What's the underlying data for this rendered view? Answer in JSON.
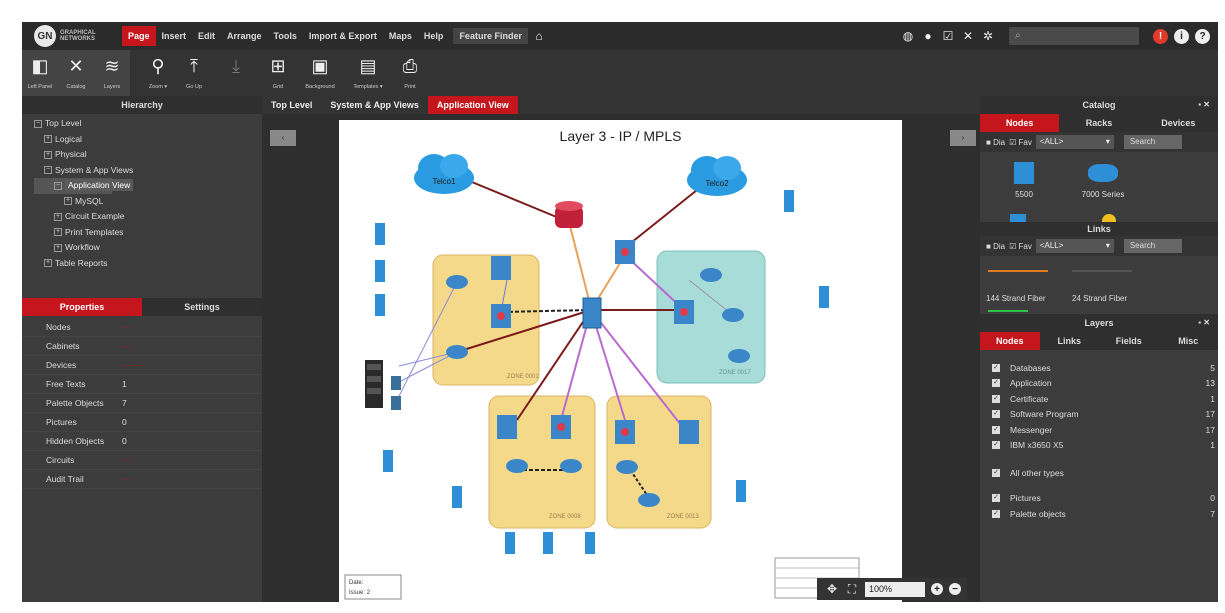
{
  "menu": {
    "logo_text": [
      "GRAPHICAL",
      "NETWORKS"
    ],
    "logo_mark": "GN",
    "items": [
      "Page",
      "Insert",
      "Edit",
      "Arrange",
      "Tools",
      "Import & Export",
      "Maps",
      "Help"
    ],
    "active": "Page",
    "feature_finder": "Feature Finder",
    "right_icons": [
      "globe-icon",
      "circle-icon",
      "checkbox-icon",
      "tools-icon",
      "gear-icon"
    ],
    "search_glyph": "⌕",
    "alert_circles": [
      "!",
      "i",
      "?"
    ]
  },
  "toolbar": [
    {
      "label": "Left Panel",
      "glyph": "◧",
      "icon": "left-panel-icon"
    },
    {
      "label": "Catalog",
      "glyph": "✕",
      "icon": "catalog-icon"
    },
    {
      "label": "Layers",
      "glyph": "≋",
      "icon": "layers-icon"
    },
    {
      "label": "Zoom ▾",
      "glyph": "⚲",
      "icon": "zoom-icon"
    },
    {
      "label": "Go Up",
      "glyph": "⤒",
      "icon": "go-up-icon"
    },
    {
      "label": "",
      "glyph": "⤓",
      "icon": "download-icon",
      "dim": true
    },
    {
      "label": "Grid",
      "glyph": "⊞",
      "icon": "grid-icon"
    },
    {
      "label": "Background",
      "glyph": "▣",
      "icon": "background-icon"
    },
    {
      "label": "Templates ▾",
      "glyph": "▤",
      "icon": "templates-icon"
    },
    {
      "label": "Print",
      "glyph": "⎙",
      "icon": "print-icon"
    }
  ],
  "hierarchy": {
    "title": "Hierarchy",
    "nodes": [
      {
        "label": "Top Level",
        "indent": 0,
        "box": "−"
      },
      {
        "label": "Logical",
        "indent": 1,
        "box": "+"
      },
      {
        "label": "Physical",
        "indent": 1,
        "box": "+"
      },
      {
        "label": "System & App Views",
        "indent": 1,
        "box": "−"
      },
      {
        "label": "Application View",
        "indent": 2,
        "box": "−",
        "selected": true
      },
      {
        "label": "MySQL",
        "indent": 3,
        "box": "+"
      },
      {
        "label": "Circuit Example",
        "indent": 2,
        "box": "+"
      },
      {
        "label": "Print Templates",
        "indent": 2,
        "box": "+"
      },
      {
        "label": "Workflow",
        "indent": 2,
        "box": "+"
      },
      {
        "label": "Table Reports",
        "indent": 1,
        "box": "+"
      }
    ]
  },
  "properties": {
    "tabs": [
      "Properties",
      "Settings"
    ],
    "rows": [
      {
        "key": "Nodes",
        "value": "—",
        "red": true
      },
      {
        "key": "Cabinets",
        "value": "—",
        "red": true
      },
      {
        "key": "Devices",
        "value": "— —",
        "red": true
      },
      {
        "key": "Free Texts",
        "value": "1"
      },
      {
        "key": "Palette Objects",
        "value": "7"
      },
      {
        "key": "Pictures",
        "value": "0"
      },
      {
        "key": "Hidden Objects",
        "value": "0"
      },
      {
        "key": "Circuits",
        "value": "—",
        "red": true
      },
      {
        "key": "Audit Trail",
        "value": "—",
        "red": true
      }
    ]
  },
  "center": {
    "tabs": [
      "Top Level",
      "System & App Views",
      "Application View"
    ],
    "active_tab": "Application View",
    "prev_glyph": "‹",
    "next_glyph": "›",
    "canvas_title": "Layer 3 - IP / MPLS",
    "clouds": [
      "Telco1",
      "Telco2"
    ],
    "zones": [
      "ZONE 0001",
      "ZONE 0017",
      "ZONE 0008",
      "ZONE 0013"
    ],
    "notes": [
      "Date:",
      "Issue: 2"
    ],
    "zoom": "100%"
  },
  "catalog": {
    "title": "Catalog",
    "tabs": [
      "Nodes",
      "Racks",
      "Devices"
    ],
    "filter": {
      "dia": "Dia",
      "fav": "Fav",
      "select": "<ALL>",
      "search": "Search"
    },
    "items": [
      "5500",
      "7000 Series"
    ],
    "links_title": "Links",
    "links": [
      "144 Strand Fiber",
      "24 Strand Fiber"
    ]
  },
  "layers": {
    "title": "Layers",
    "tabs": [
      "Nodes",
      "Links",
      "Fields",
      "Misc"
    ],
    "rows": [
      {
        "name": "Databases",
        "count": "5"
      },
      {
        "name": "Application",
        "count": "13"
      },
      {
        "name": "Certificate",
        "count": "1"
      },
      {
        "name": "Software Program",
        "count": "17"
      },
      {
        "name": "Messenger",
        "count": "17"
      },
      {
        "name": "IBM x3650 X5",
        "count": "1"
      }
    ],
    "other": "All other types",
    "extra": [
      {
        "name": "Pictures",
        "count": "0"
      },
      {
        "name": "Palette objects",
        "count": "7"
      }
    ]
  },
  "colors": {
    "accent": "#c4161c",
    "zone_yellow": "#f5d98a",
    "zone_teal": "#a8dcd8"
  }
}
